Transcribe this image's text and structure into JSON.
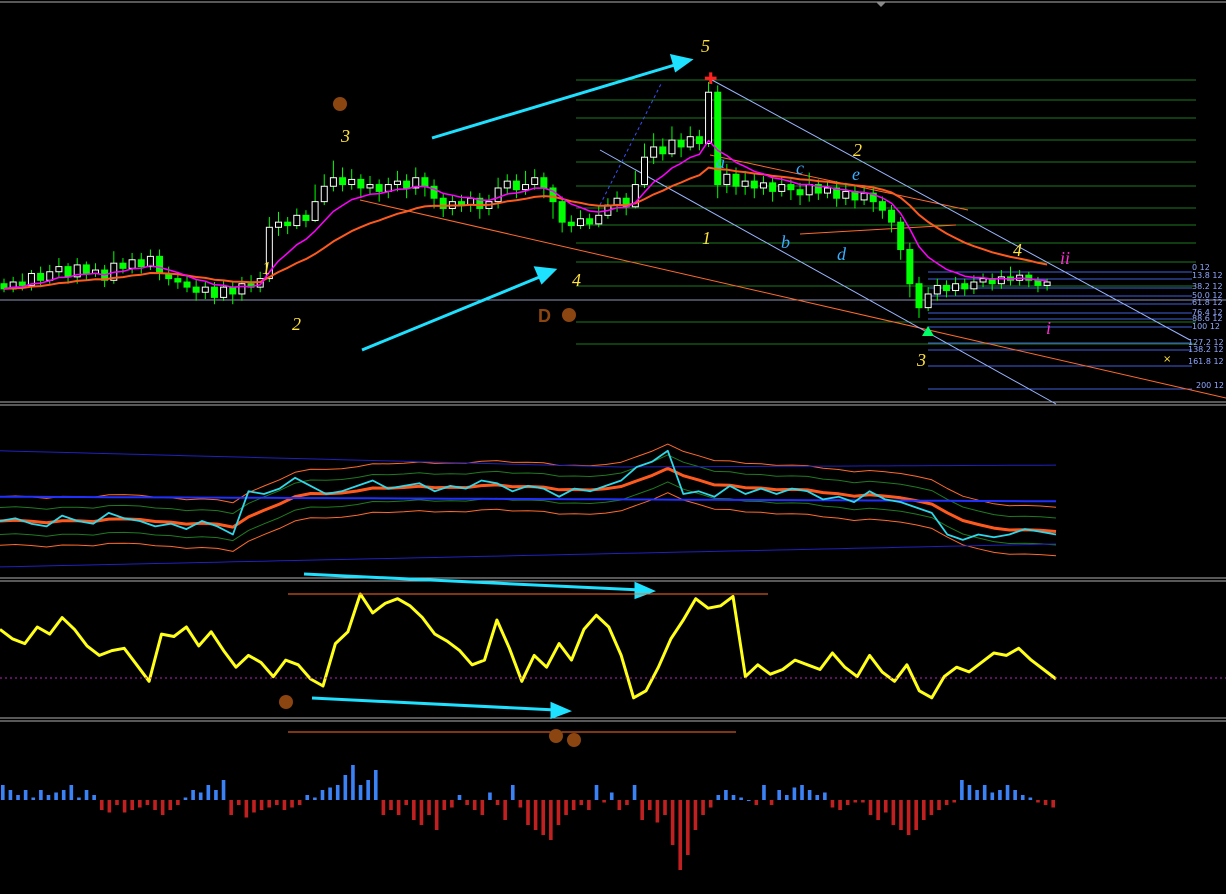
{
  "colors": {
    "background": "#000000",
    "candle_bull": "#ffffff",
    "candle_bear": "#00ff00",
    "ma_fast": "#ff00ff",
    "ma_slow": "#ff5a1e",
    "fib_grid": "#1f7a1f",
    "fib_levels": "#3f5fd8",
    "channel": "#9ab6ff",
    "trendline": "#ff6a2a",
    "arrow": "#1ee0ff",
    "wave_yellow": "#ffe23a",
    "wave_blue": "#3aaeff",
    "wave_magenta": "#ff2bd6",
    "osc_line": "#ffff19",
    "hist_up": "#3b82f6",
    "hist_down": "#c02020",
    "dot": "#8b4510",
    "panel_separator": "#b0b0b0"
  },
  "chart_data": [
    {
      "type": "candlestick",
      "panel": "price",
      "candles": [
        [
          0,
          60,
          57,
          63,
          55
        ],
        [
          1,
          57,
          61,
          64,
          55
        ],
        [
          2,
          61,
          59,
          66,
          56
        ],
        [
          3,
          59,
          66,
          68,
          56
        ],
        [
          4,
          66,
          62,
          70,
          58
        ],
        [
          5,
          62,
          67,
          71,
          60
        ],
        [
          6,
          67,
          70,
          75,
          64
        ],
        [
          7,
          70,
          64,
          72,
          60
        ],
        [
          8,
          64,
          71,
          75,
          60
        ],
        [
          9,
          71,
          66,
          73,
          62
        ],
        [
          10,
          66,
          68,
          72,
          64
        ],
        [
          11,
          68,
          62,
          71,
          58
        ],
        [
          12,
          62,
          72,
          79,
          60
        ],
        [
          13,
          72,
          69,
          75,
          66
        ],
        [
          14,
          69,
          74,
          78,
          66
        ],
        [
          15,
          74,
          70,
          78,
          66
        ],
        [
          16,
          70,
          76,
          80,
          68
        ],
        [
          17,
          76,
          66,
          80,
          62
        ],
        [
          18,
          66,
          63,
          70,
          59
        ],
        [
          19,
          63,
          61,
          67,
          57
        ],
        [
          20,
          61,
          58,
          65,
          55
        ],
        [
          21,
          58,
          55,
          62,
          50
        ],
        [
          22,
          55,
          58,
          61,
          51
        ],
        [
          23,
          58,
          52,
          61,
          48
        ],
        [
          24,
          52,
          58,
          62,
          50
        ],
        [
          25,
          58,
          54,
          61,
          48
        ],
        [
          26,
          54,
          60,
          64,
          50
        ],
        [
          27,
          60,
          58,
          65,
          55
        ],
        [
          28,
          58,
          63,
          67,
          55
        ],
        [
          29,
          63,
          93,
          99,
          61
        ],
        [
          30,
          93,
          96,
          102,
          88
        ],
        [
          31,
          96,
          94,
          99,
          89
        ],
        [
          32,
          94,
          100,
          104,
          92
        ],
        [
          33,
          100,
          97,
          103,
          93
        ],
        [
          34,
          97,
          108,
          118,
          96
        ],
        [
          35,
          108,
          117,
          124,
          106
        ],
        [
          36,
          117,
          122,
          132,
          114
        ],
        [
          37,
          122,
          118,
          128,
          114
        ],
        [
          38,
          118,
          121,
          127,
          115
        ],
        [
          39,
          121,
          116,
          124,
          110
        ],
        [
          40,
          116,
          118,
          123,
          112
        ],
        [
          41,
          118,
          114,
          121,
          108
        ],
        [
          42,
          114,
          118,
          122,
          110
        ],
        [
          43,
          118,
          120,
          126,
          114
        ],
        [
          44,
          120,
          116,
          124,
          110
        ],
        [
          45,
          116,
          122,
          128,
          112
        ],
        [
          46,
          122,
          117,
          125,
          111
        ],
        [
          47,
          117,
          110,
          121,
          104
        ],
        [
          48,
          110,
          104,
          113,
          99
        ],
        [
          49,
          104,
          108,
          112,
          100
        ],
        [
          50,
          108,
          106,
          112,
          102
        ],
        [
          51,
          106,
          110,
          114,
          102
        ],
        [
          52,
          110,
          104,
          113,
          98
        ],
        [
          53,
          104,
          108,
          112,
          100
        ],
        [
          54,
          108,
          116,
          122,
          104
        ],
        [
          55,
          116,
          120,
          124,
          112
        ],
        [
          56,
          120,
          115,
          124,
          110
        ],
        [
          57,
          115,
          118,
          126,
          112
        ],
        [
          58,
          118,
          122,
          127,
          115
        ],
        [
          59,
          122,
          116,
          125,
          110
        ],
        [
          60,
          116,
          108,
          118,
          98
        ],
        [
          61,
          108,
          96,
          111,
          90
        ],
        [
          62,
          96,
          94,
          100,
          90
        ],
        [
          63,
          94,
          98,
          103,
          92
        ],
        [
          64,
          98,
          95,
          101,
          92
        ],
        [
          65,
          95,
          100,
          106,
          93
        ],
        [
          66,
          100,
          106,
          110,
          98
        ],
        [
          67,
          106,
          110,
          114,
          102
        ],
        [
          68,
          110,
          105,
          113,
          100
        ],
        [
          69,
          105,
          118,
          126,
          104
        ],
        [
          70,
          118,
          134,
          142,
          116
        ],
        [
          71,
          134,
          140,
          148,
          130
        ],
        [
          72,
          140,
          136,
          145,
          132
        ],
        [
          73,
          136,
          144,
          152,
          134
        ],
        [
          74,
          144,
          140,
          148,
          134
        ],
        [
          75,
          140,
          146,
          152,
          138
        ],
        [
          76,
          146,
          142,
          150,
          138
        ],
        [
          77,
          142,
          172,
          178,
          140
        ],
        [
          78,
          172,
          118,
          176,
          110
        ],
        [
          79,
          118,
          124,
          130,
          113
        ],
        [
          80,
          124,
          117,
          128,
          112
        ],
        [
          81,
          117,
          120,
          126,
          112
        ],
        [
          82,
          120,
          116,
          124,
          110
        ],
        [
          83,
          116,
          119,
          123,
          112
        ],
        [
          84,
          119,
          114,
          122,
          108
        ],
        [
          85,
          114,
          118,
          123,
          111
        ],
        [
          86,
          118,
          115,
          121,
          109
        ],
        [
          87,
          115,
          112,
          119,
          106
        ],
        [
          88,
          112,
          118,
          125,
          108
        ],
        [
          89,
          118,
          113,
          121,
          109
        ],
        [
          90,
          113,
          116,
          120,
          110
        ],
        [
          91,
          116,
          110,
          120,
          105
        ],
        [
          92,
          110,
          114,
          119,
          106
        ],
        [
          93,
          114,
          109,
          118,
          104
        ],
        [
          94,
          109,
          113,
          117,
          106
        ],
        [
          95,
          113,
          108,
          116,
          102
        ],
        [
          96,
          108,
          103,
          111,
          98
        ],
        [
          97,
          103,
          96,
          106,
          90
        ],
        [
          98,
          96,
          80,
          99,
          74
        ],
        [
          99,
          80,
          60,
          84,
          52
        ],
        [
          100,
          60,
          46,
          64,
          40
        ],
        [
          101,
          46,
          54,
          58,
          44
        ],
        [
          102,
          54,
          59,
          63,
          50
        ],
        [
          103,
          59,
          56,
          62,
          52
        ],
        [
          104,
          56,
          60,
          64,
          53
        ],
        [
          105,
          60,
          57,
          63,
          53
        ],
        [
          106,
          57,
          61,
          65,
          54
        ],
        [
          107,
          61,
          63,
          66,
          58
        ],
        [
          108,
          63,
          60,
          66,
          56
        ],
        [
          109,
          60,
          64,
          68,
          57
        ],
        [
          110,
          64,
          62,
          70,
          59
        ],
        [
          111,
          62,
          65,
          68,
          59
        ],
        [
          112,
          65,
          62,
          67,
          58
        ],
        [
          113,
          62,
          59,
          64,
          55
        ],
        [
          114,
          59,
          61,
          63,
          56
        ]
      ],
      "ma_fast_period": 8,
      "ma_slow_period": 21,
      "wave_labels": [
        {
          "text": "1",
          "color": "yellow"
        },
        {
          "text": "2",
          "color": "yellow"
        },
        {
          "text": "3",
          "color": "yellow"
        },
        {
          "text": "4",
          "color": "yellow"
        },
        {
          "text": "5",
          "color": "yellow"
        },
        {
          "text": "1",
          "color": "yellow"
        },
        {
          "text": "a",
          "color": "blue"
        },
        {
          "text": "b",
          "color": "blue"
        },
        {
          "text": "c",
          "color": "blue"
        },
        {
          "text": "d",
          "color": "blue"
        },
        {
          "text": "e",
          "color": "blue"
        },
        {
          "text": "2",
          "color": "yellow"
        },
        {
          "text": "3",
          "color": "yellow"
        },
        {
          "text": "4",
          "color": "yellow"
        },
        {
          "text": "ii",
          "color": "magenta"
        },
        {
          "text": "i",
          "color": "magenta"
        },
        {
          "text": "D",
          "color": "dot"
        }
      ],
      "fib_levels": [
        "0 12",
        "13.8 12",
        "38.2 12",
        "50.0 12",
        "61.8 12",
        "76.4 12",
        "88.6 12",
        "100 12",
        "127.2 12",
        "138.2 12",
        "161.8 12",
        "200 12"
      ]
    },
    {
      "type": "line",
      "panel": "bands",
      "series": [
        {
          "values": [
            40,
            42,
            38,
            36,
            44,
            40,
            38,
            46,
            42,
            40,
            36,
            38,
            34,
            40,
            36,
            30,
            62,
            60,
            64,
            72,
            66,
            60,
            62,
            66,
            70,
            64,
            66,
            68,
            62,
            66,
            64,
            70,
            68,
            62,
            66,
            64,
            58,
            64,
            62,
            66,
            70,
            80,
            84,
            92,
            60,
            62,
            58,
            66,
            60,
            64,
            60,
            64,
            62,
            56,
            58,
            54,
            62,
            56,
            54,
            50,
            46,
            30,
            26,
            30,
            28,
            30,
            34,
            32,
            30
          ]
        }
      ]
    },
    {
      "type": "line",
      "panel": "oscillator",
      "series": [
        {
          "values": [
            70,
            62,
            58,
            72,
            66,
            80,
            70,
            56,
            48,
            52,
            54,
            40,
            26,
            66,
            64,
            72,
            56,
            68,
            52,
            38,
            48,
            42,
            30,
            44,
            40,
            28,
            22,
            58,
            68,
            100,
            84,
            92,
            96,
            90,
            80,
            66,
            60,
            52,
            40,
            44,
            78,
            54,
            26,
            48,
            38,
            58,
            44,
            70,
            82,
            72,
            48,
            12,
            18,
            38,
            62,
            78,
            96,
            88,
            90,
            98,
            30,
            40,
            32,
            36,
            44,
            40,
            36,
            50,
            38,
            30,
            48,
            34,
            26,
            40,
            18,
            12,
            30,
            38,
            34,
            42,
            50,
            48,
            54,
            44,
            36,
            28
          ]
        }
      ]
    },
    {
      "type": "bar",
      "panel": "histogram",
      "values": [
        6,
        4,
        2,
        4,
        1,
        4,
        2,
        3,
        4,
        6,
        1,
        4,
        2,
        -4,
        -5,
        -2,
        -5,
        -4,
        -3,
        -2,
        -4,
        -6,
        -4,
        -2,
        1,
        4,
        3,
        6,
        4,
        8,
        -6,
        -2,
        -7,
        -5,
        -4,
        -3,
        -2,
        -4,
        -3,
        -2,
        2,
        1,
        4,
        5,
        6,
        10,
        14,
        6,
        8,
        12,
        -6,
        -4,
        -6,
        -2,
        -8,
        -10,
        -6,
        -12,
        -4,
        -3,
        2,
        -2,
        -4,
        -6,
        3,
        -2,
        -8,
        6,
        -3,
        -10,
        -12,
        -14,
        -16,
        -10,
        -6,
        -4,
        -2,
        -4,
        6,
        -1,
        3,
        -4,
        -2,
        6,
        -8,
        -4,
        -9,
        -6,
        -18,
        -28,
        -22,
        -12,
        -6,
        -3,
        2,
        4,
        2,
        1,
        0,
        -2,
        6,
        -2,
        4,
        2,
        5,
        6,
        4,
        2,
        3,
        -3,
        -4,
        -2,
        -1,
        -1,
        -6,
        -8,
        -5,
        -10,
        -12,
        -14,
        -12,
        -8,
        -6,
        -4,
        -2,
        -1,
        8,
        6,
        4,
        6,
        3,
        4,
        6,
        4,
        2,
        1,
        -1,
        -2,
        -3
      ]
    }
  ]
}
